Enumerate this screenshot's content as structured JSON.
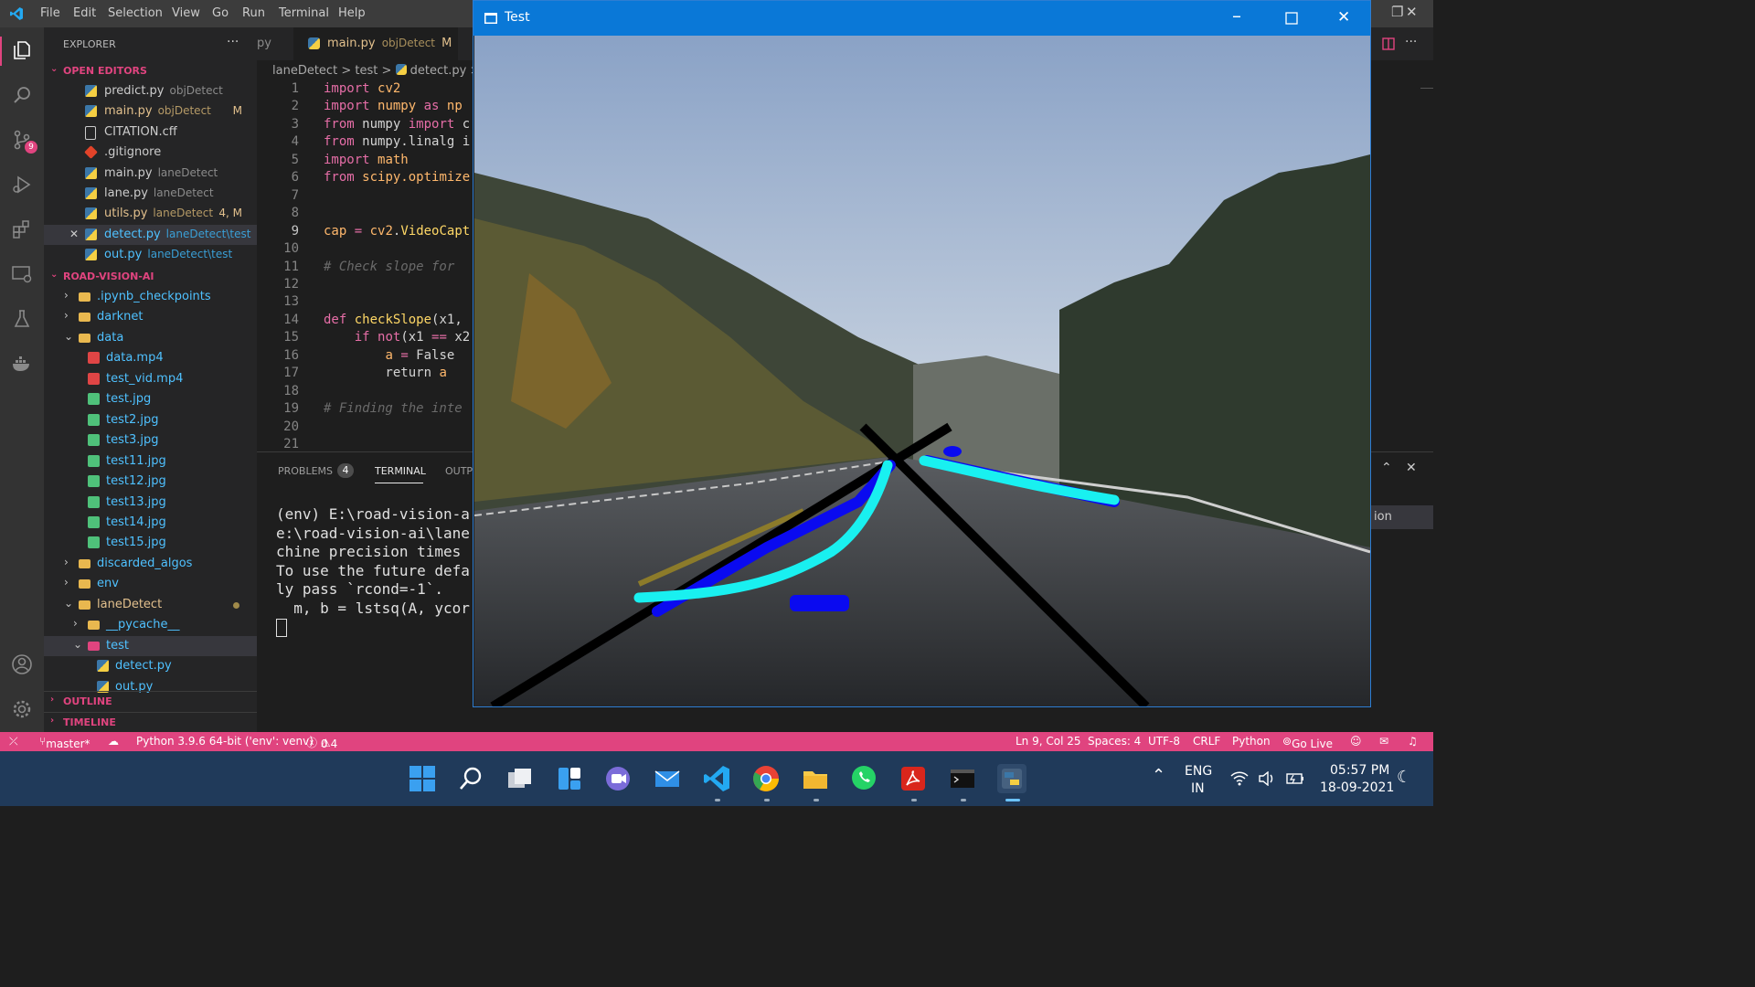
{
  "menu": [
    "File",
    "Edit",
    "Selection",
    "View",
    "Go",
    "Run",
    "Terminal",
    "Help"
  ],
  "activity": {
    "scm_badge": "9"
  },
  "sidebar": {
    "title": "EXPLORER",
    "more": "···",
    "open_editors_label": "OPEN EDITORS",
    "open_editors": [
      {
        "name": "predict.py",
        "desc": "objDetect",
        "status": "",
        "kind": "py",
        "color": "#cccccc"
      },
      {
        "name": "main.py",
        "desc": "objDetect",
        "status": "M",
        "kind": "py",
        "color": "#e2c08d"
      },
      {
        "name": "CITATION.cff",
        "desc": "",
        "status": "",
        "kind": "file",
        "color": "#cccccc"
      },
      {
        "name": ".gitignore",
        "desc": "",
        "status": "",
        "kind": "git",
        "color": "#cccccc"
      },
      {
        "name": "main.py",
        "desc": "laneDetect",
        "status": "",
        "kind": "py",
        "color": "#cccccc"
      },
      {
        "name": "lane.py",
        "desc": "laneDetect",
        "status": "",
        "kind": "py",
        "color": "#cccccc"
      },
      {
        "name": "utils.py",
        "desc": "laneDetect",
        "status": "4, M",
        "kind": "py",
        "color": "#e2c08d"
      },
      {
        "name": "detect.py",
        "desc": "laneDetect\\test",
        "status": "",
        "kind": "py",
        "color": "#4fc1ff",
        "selected": true
      },
      {
        "name": "out.py",
        "desc": "laneDetect\\test",
        "status": "",
        "kind": "py",
        "color": "#4fc1ff"
      }
    ],
    "project_label": "ROAD-VISION-AI",
    "tree": [
      {
        "name": ".ipynb_checkpoints",
        "kind": "folder",
        "indent": 1,
        "chev": "›"
      },
      {
        "name": "darknet",
        "kind": "folder",
        "indent": 1,
        "chev": "›"
      },
      {
        "name": "data",
        "kind": "folder-open",
        "indent": 1,
        "chev": "⌄"
      },
      {
        "name": "data.mp4",
        "kind": "video",
        "indent": 2
      },
      {
        "name": "test_vid.mp4",
        "kind": "video",
        "indent": 2
      },
      {
        "name": "test.jpg",
        "kind": "img",
        "indent": 2
      },
      {
        "name": "test2.jpg",
        "kind": "img",
        "indent": 2
      },
      {
        "name": "test3.jpg",
        "kind": "img",
        "indent": 2
      },
      {
        "name": "test11.jpg",
        "kind": "img",
        "indent": 2
      },
      {
        "name": "test12.jpg",
        "kind": "img",
        "indent": 2
      },
      {
        "name": "test13.jpg",
        "kind": "img",
        "indent": 2
      },
      {
        "name": "test14.jpg",
        "kind": "img",
        "indent": 2
      },
      {
        "name": "test15.jpg",
        "kind": "img",
        "indent": 2
      },
      {
        "name": "discarded_algos",
        "kind": "folder",
        "indent": 1,
        "chev": "›"
      },
      {
        "name": "env",
        "kind": "folder",
        "indent": 1,
        "chev": "›"
      },
      {
        "name": "laneDetect",
        "kind": "folder-open",
        "indent": 1,
        "chev": "⌄",
        "dot": true
      },
      {
        "name": "__pycache__",
        "kind": "folder",
        "indent": 2,
        "chev": "›"
      },
      {
        "name": "test",
        "kind": "folder-test",
        "indent": 2,
        "chev": "⌄",
        "selected": true
      },
      {
        "name": "detect.py",
        "kind": "py",
        "indent": 3
      },
      {
        "name": "out.py",
        "kind": "py",
        "indent": 3
      }
    ],
    "outline_label": "OUTLINE",
    "timeline_label": "TIMELINE"
  },
  "tabs": {
    "partial": "py",
    "active_name": "main.py",
    "active_desc": "objDetect",
    "active_status": "M"
  },
  "breadcrumb": [
    "laneDetect",
    ">",
    "test",
    ">",
    "detect.py",
    ">",
    "..."
  ],
  "code_lines": [
    {
      "n": "1",
      "html": "<span class='kw'>import</span> <span class='mod'>cv2</span>"
    },
    {
      "n": "2",
      "html": "<span class='kw'>import</span> <span class='mod'>numpy</span> <span class='kw'>as</span> <span class='mod'>np</span>"
    },
    {
      "n": "3",
      "html": "<span class='kw'>from</span> numpy <span class='kw'>import</span> c"
    },
    {
      "n": "4",
      "html": "<span class='kw'>from</span> numpy.linalg i"
    },
    {
      "n": "5",
      "html": "<span class='kw'>import</span> <span class='mod'>math</span>"
    },
    {
      "n": "6",
      "html": "<span class='kw'>from</span> <span class='mod'>scipy.optimize</span>"
    },
    {
      "n": "7",
      "html": ""
    },
    {
      "n": "8",
      "html": ""
    },
    {
      "n": "9",
      "html": "<span class='mod'>cap</span> <span class='kw'>=</span> <span class='mod'>cv2</span>.<span class='fn'>VideoCapt</span>"
    },
    {
      "n": "10",
      "html": ""
    },
    {
      "n": "11",
      "html": "<span class='cm'># Check slope for </span>"
    },
    {
      "n": "12",
      "html": ""
    },
    {
      "n": "13",
      "html": ""
    },
    {
      "n": "14",
      "html": "<span class='kw'>def</span> <span class='fn'>checkSlope</span>(x1,"
    },
    {
      "n": "15",
      "html": "    <span class='kw'>if</span> <span class='kw'>not</span>(x1 <span class='kw'>==</span> x2"
    },
    {
      "n": "16",
      "html": "        <span class='mod'>a</span> <span class='kw'>=</span> False "
    },
    {
      "n": "17",
      "html": "        return <span class='mod'>a</span>"
    },
    {
      "n": "18",
      "html": ""
    },
    {
      "n": "19",
      "html": "<span class='cm'># Finding the inte</span>"
    },
    {
      "n": "20",
      "html": ""
    },
    {
      "n": "21",
      "html": ""
    }
  ],
  "panel": {
    "problems_label": "PROBLEMS",
    "problems_count": "4",
    "terminal_label": "TERMINAL",
    "output_label": "OUTP",
    "side_text": "ion",
    "terminal_lines": [
      "(env) E:\\road-vision-a",
      "e:\\road-vision-ai\\lane",
      "chine precision times",
      "To use the future defa",
      "ly pass `rcond=-1`.",
      "  m, b = lstsq(A, ycor"
    ]
  },
  "statusbar": {
    "branch": "master*",
    "python": "Python 3.9.6 64-bit ('env': venv)",
    "errors": "0",
    "warnings": "4",
    "position": "Ln 9, Col 25",
    "spaces": "Spaces: 4",
    "encoding": "UTF-8",
    "eol": "CRLF",
    "language": "Python",
    "golive": "Go Live"
  },
  "testwindow": {
    "title": "Test"
  },
  "taskbar": {
    "lang": "ENG",
    "region": "IN",
    "time": "05:57 PM",
    "date": "18-09-2021"
  }
}
